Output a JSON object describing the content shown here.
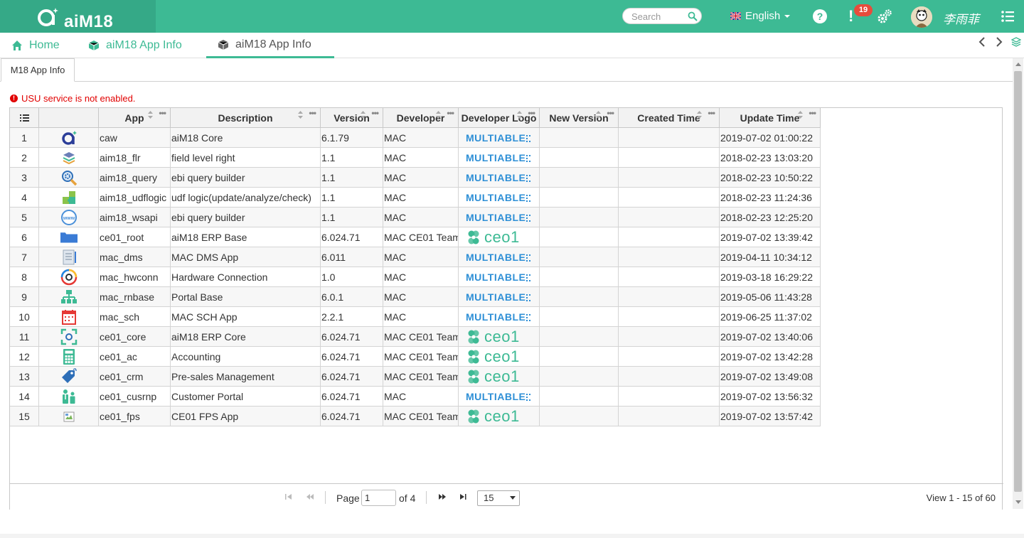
{
  "brand": {
    "name": "aiM18"
  },
  "search": {
    "placeholder": "Search"
  },
  "header": {
    "language": "English",
    "help": "?",
    "alert": "!",
    "notification_count": "19",
    "username": "李雨菲"
  },
  "tabs": [
    {
      "label": "Home",
      "icon": "home-icon"
    },
    {
      "label": "aiM18 App Info",
      "icon": "cube-icon"
    },
    {
      "label": "aiM18 App Info",
      "icon": "cube-icon",
      "active": true
    }
  ],
  "subtab": {
    "label": "M18 App Info"
  },
  "warning": {
    "icon": "!",
    "text": "USU service is not enabled."
  },
  "grid": {
    "columns": [
      "App",
      "Description",
      "Version",
      "Developer",
      "Developer Logo",
      "New Version",
      "Created Time",
      "Update Time"
    ],
    "rows": [
      {
        "n": "1",
        "icon": "caw-logo-icon",
        "app": "caw",
        "desc": "aiM18 Core",
        "version": "6.1.79",
        "dev": "MAC",
        "logo": "MULTIABLE",
        "newver": "",
        "created": "",
        "updated": "2019-07-02 01:00:22"
      },
      {
        "n": "2",
        "icon": "cube-layers-icon",
        "app": "aim18_flr",
        "desc": "field level right",
        "version": "1.1",
        "dev": "MAC",
        "logo": "MULTIABLE",
        "newver": "",
        "created": "",
        "updated": "2018-02-23 13:03:20"
      },
      {
        "n": "3",
        "icon": "magnifier-gear-icon",
        "app": "aim18_query",
        "desc": "ebi query builder",
        "version": "1.1",
        "dev": "MAC",
        "logo": "MULTIABLE",
        "newver": "",
        "created": "",
        "updated": "2018-02-23 10:50:22"
      },
      {
        "n": "4",
        "icon": "puzzle-icon",
        "app": "aim18_udflogic",
        "desc": "udf logic(update/analyze/check)",
        "version": "1.1",
        "dev": "MAC",
        "logo": "MULTIABLE",
        "newver": "",
        "created": "",
        "updated": "2018-02-23 11:24:36"
      },
      {
        "n": "5",
        "icon": "www-globe-icon",
        "app": "aim18_wsapi",
        "desc": "ebi query builder",
        "version": "1.1",
        "dev": "MAC",
        "logo": "MULTIABLE",
        "newver": "",
        "created": "",
        "updated": "2018-02-23 12:25:20"
      },
      {
        "n": "6",
        "icon": "folder-icon",
        "app": "ce01_root",
        "desc": "aiM18 ERP Base",
        "version": "6.024.71",
        "dev": "MAC CE01 Team",
        "logo": "ceo1",
        "newver": "",
        "created": "",
        "updated": "2019-07-02 13:39:42"
      },
      {
        "n": "7",
        "icon": "document-icon",
        "app": "mac_dms",
        "desc": "MAC DMS App",
        "version": "6.011",
        "dev": "MAC",
        "logo": "MULTIABLE",
        "newver": "",
        "created": "",
        "updated": "2019-04-11 10:34:12"
      },
      {
        "n": "8",
        "icon": "hardware-ring-icon",
        "app": "mac_hwconn",
        "desc": "Hardware Connection",
        "version": "1.0",
        "dev": "MAC",
        "logo": "MULTIABLE",
        "newver": "",
        "created": "",
        "updated": "2019-03-18 16:29:22"
      },
      {
        "n": "9",
        "icon": "sitemap-icon",
        "app": "mac_rnbase",
        "desc": "Portal Base",
        "version": "6.0.1",
        "dev": "MAC",
        "logo": "MULTIABLE",
        "newver": "",
        "created": "",
        "updated": "2019-05-06 11:43:28"
      },
      {
        "n": "10",
        "icon": "calendar-icon",
        "app": "mac_sch",
        "desc": "MAC SCH App",
        "version": "2.2.1",
        "dev": "MAC",
        "logo": "MULTIABLE",
        "newver": "",
        "created": "",
        "updated": "2019-06-25 11:37:02"
      },
      {
        "n": "11",
        "icon": "focus-frame-icon",
        "app": "ce01_core",
        "desc": "aiM18 ERP Core",
        "version": "6.024.71",
        "dev": "MAC CE01 Team",
        "logo": "ceo1",
        "newver": "",
        "created": "",
        "updated": "2019-07-02 13:40:06"
      },
      {
        "n": "12",
        "icon": "calculator-icon",
        "app": "ce01_ac",
        "desc": "Accounting",
        "version": "6.024.71",
        "dev": "MAC CE01 Team",
        "logo": "ceo1",
        "newver": "",
        "created": "",
        "updated": "2019-07-02 13:42:28"
      },
      {
        "n": "13",
        "icon": "tag-icon",
        "app": "ce01_crm",
        "desc": "Pre-sales Management",
        "version": "6.024.71",
        "dev": "MAC CE01 Team",
        "logo": "ceo1",
        "newver": "",
        "created": "",
        "updated": "2019-07-02 13:49:08"
      },
      {
        "n": "14",
        "icon": "customer-icon",
        "app": "ce01_cusrnp",
        "desc": "Customer Portal",
        "version": "6.024.71",
        "dev": "MAC",
        "logo": "MULTIABLE",
        "newver": "",
        "created": "",
        "updated": "2019-07-02 13:56:32"
      },
      {
        "n": "15",
        "icon": "broken-image-icon",
        "app": "ce01_fps",
        "desc": "CE01 FPS App",
        "version": "6.024.71",
        "dev": "MAC CE01 Team",
        "logo": "ceo1",
        "newver": "",
        "created": "",
        "updated": "2019-07-02 13:57:42"
      }
    ]
  },
  "pager": {
    "page_label": "Page",
    "page_value": "1",
    "of_label": "of 4",
    "page_size": "15",
    "view_text": "View 1 - 15 of 60"
  },
  "colors": {
    "brand": "#3dba94",
    "brand_dark": "#35a987",
    "alert": "#e74c3c",
    "warning": "#e10000",
    "multiable_blue": "#2e8fd6"
  }
}
